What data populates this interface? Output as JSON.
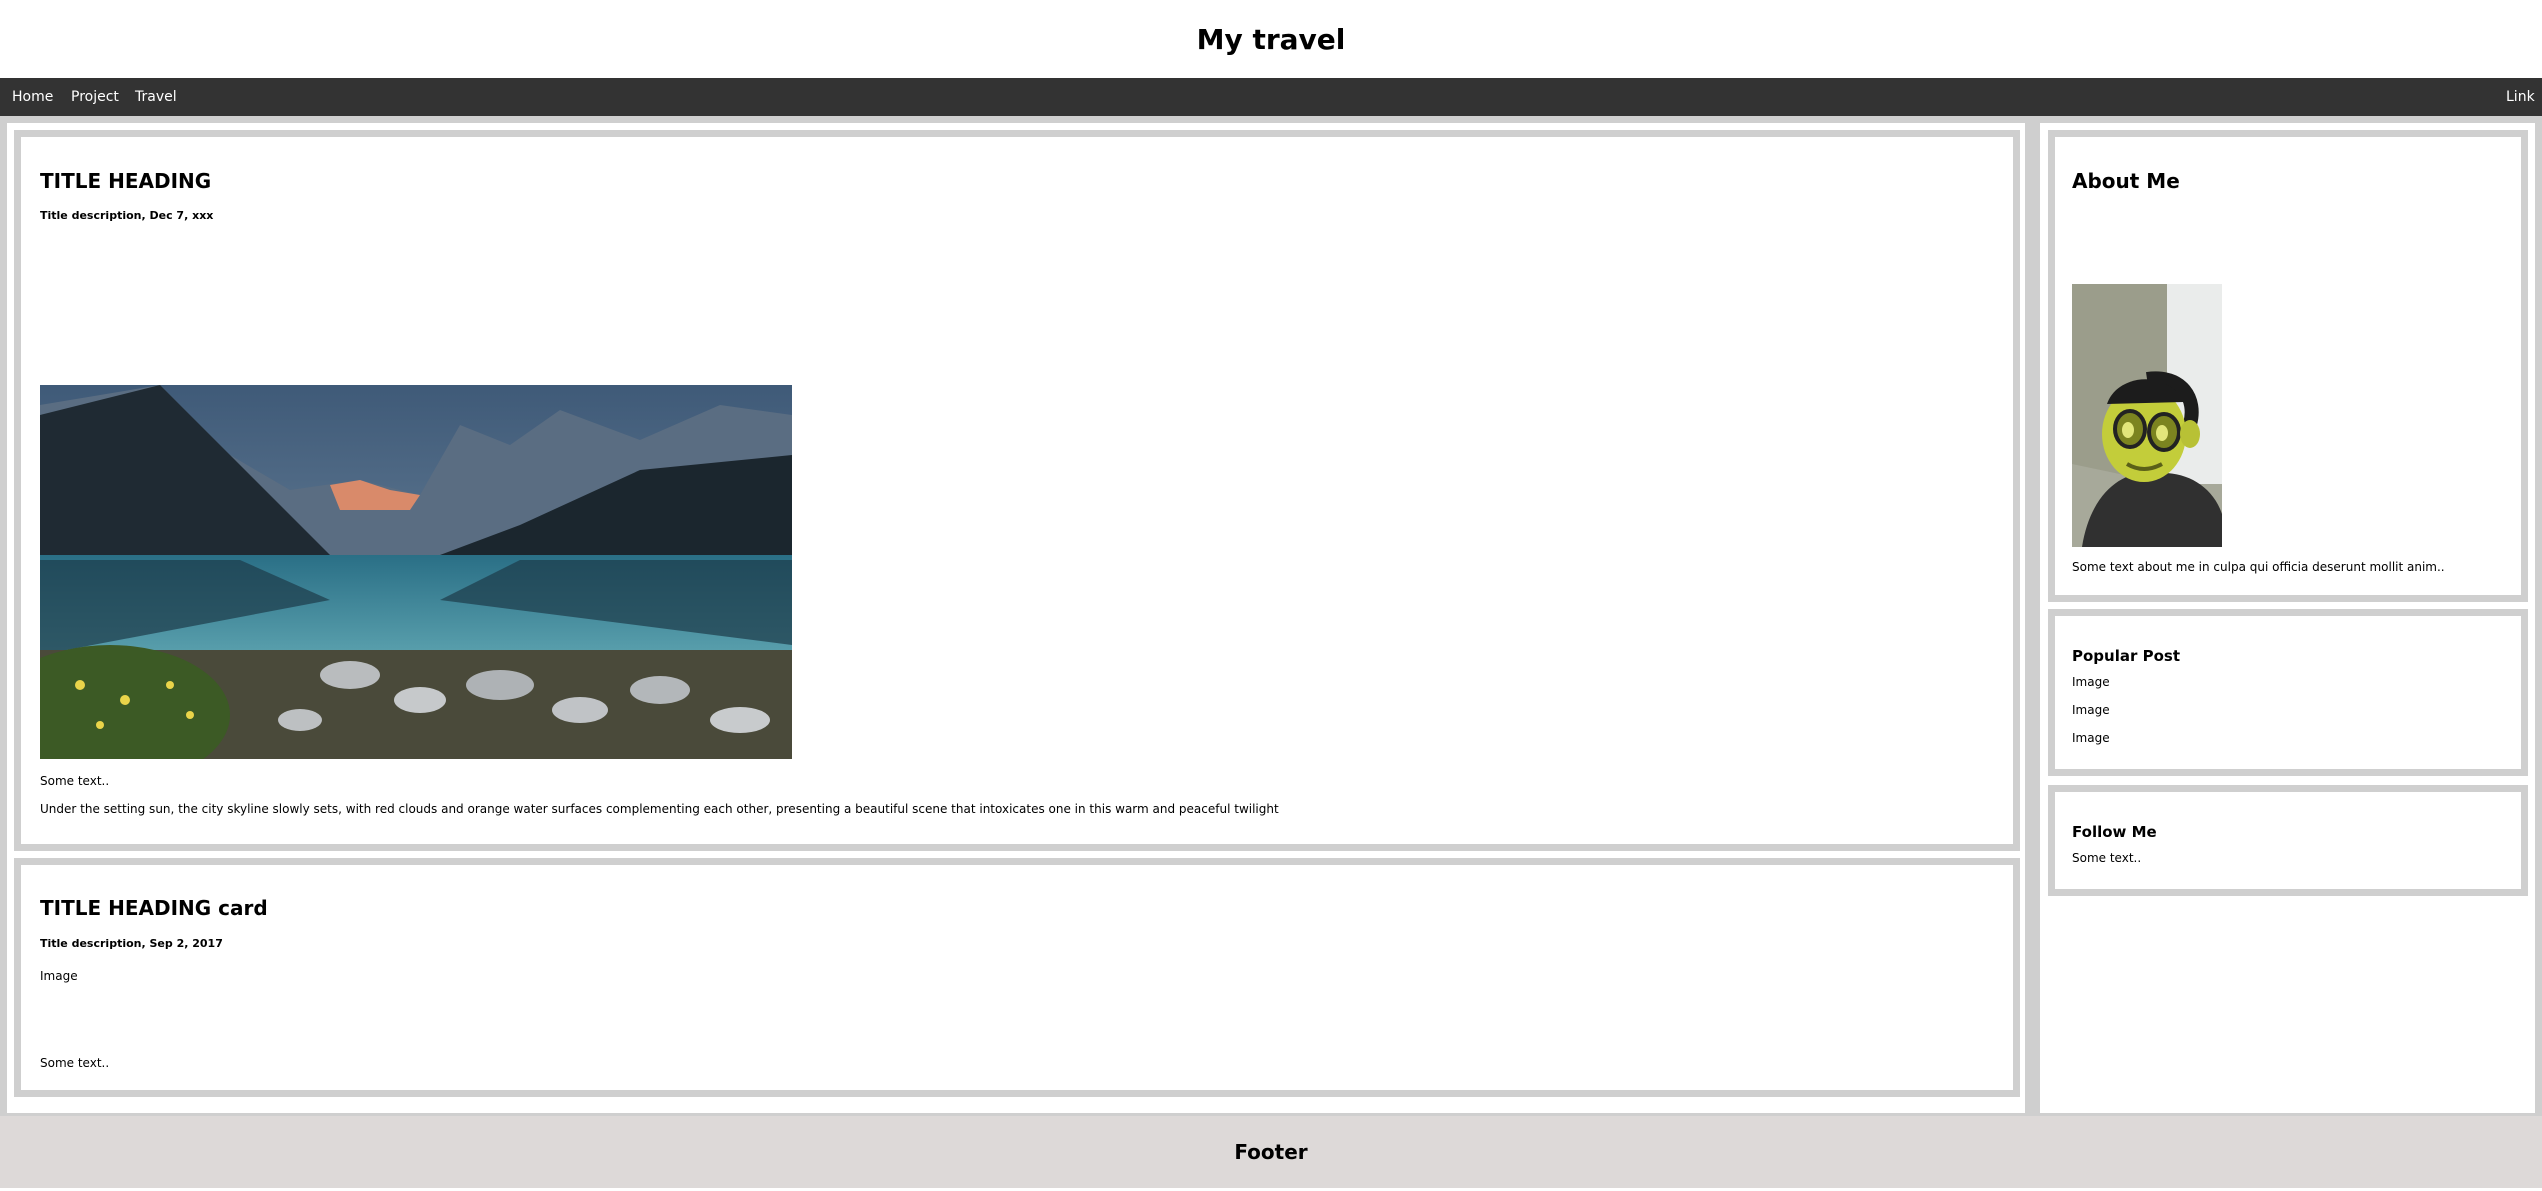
{
  "header": {
    "title": "My travel"
  },
  "nav": {
    "home": "Home",
    "project": "Project",
    "travel": "Travel",
    "link": "Link"
  },
  "post1": {
    "title": "TITLE HEADING",
    "description": "Title description, Dec 7, xxx",
    "intro": "Some text..",
    "body": "Under the setting sun, the city skyline slowly sets, with red clouds and orange water surfaces complementing each other, presenting a beautiful scene that intoxicates one in this warm and peaceful twilight"
  },
  "post2": {
    "title": "TITLE HEADING card",
    "description": "Title description, Sep 2, 2017",
    "image_label": "Image",
    "text": "Some text.."
  },
  "about": {
    "title": "About Me",
    "text": "Some text about me in culpa qui officia deserunt mollit anim.."
  },
  "popular": {
    "title": "Popular Post",
    "items": [
      "Image",
      "Image",
      "Image"
    ]
  },
  "follow": {
    "title": "Follow Me",
    "text": "Some text.."
  },
  "footer": {
    "title": "Footer"
  }
}
